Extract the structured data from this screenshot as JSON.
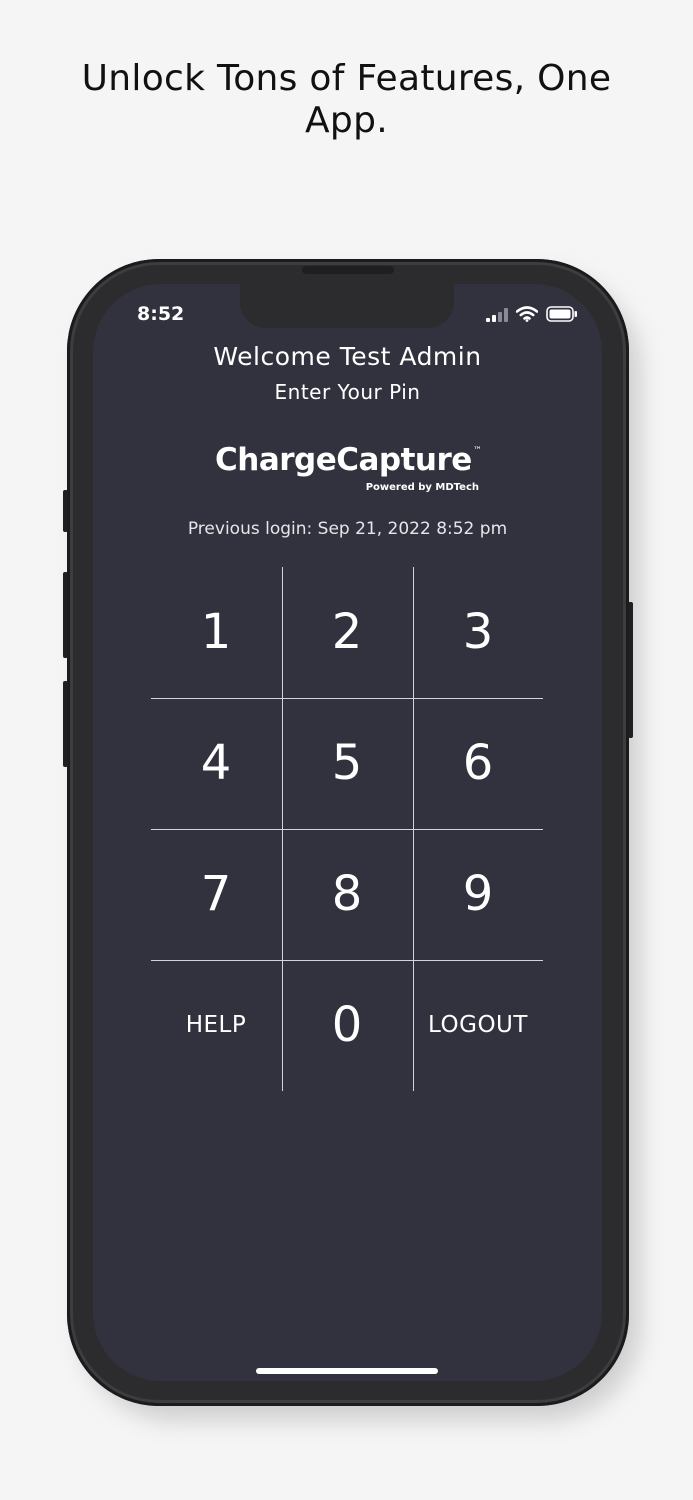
{
  "promo": {
    "headline": "Unlock Tons of Features, One App."
  },
  "status_bar": {
    "time": "8:52",
    "icons": [
      "signal-icon",
      "wifi-icon",
      "battery-icon"
    ]
  },
  "header": {
    "welcome": "Welcome Test Admin",
    "instruction": "Enter Your Pin"
  },
  "logo": {
    "name": "ChargeCapture",
    "trademark": "™",
    "tagline": "Powered by MDTech"
  },
  "login_info": {
    "previous_login": "Previous login: Sep 21, 2022 8:52 pm"
  },
  "keypad": {
    "keys": [
      "1",
      "2",
      "3",
      "4",
      "5",
      "6",
      "7",
      "8",
      "9",
      "HELP",
      "0",
      "LOGOUT"
    ]
  },
  "colors": {
    "screen_background": "#32323f",
    "text": "#ffffff",
    "page_background": "#f5f5f5",
    "phone_frame": "#2c2c2e"
  }
}
